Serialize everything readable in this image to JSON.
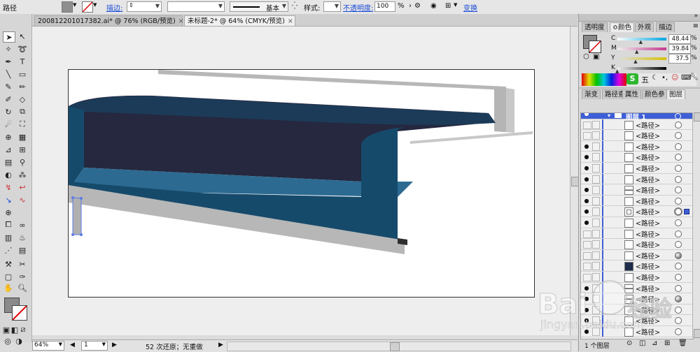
{
  "control_bar": {
    "object_type": "路径",
    "stroke_label": "描边:",
    "stroke_profile": "基本",
    "style_label": "样式:",
    "opacity_label": "不透明度:",
    "opacity_value": "100",
    "opacity_unit": "%",
    "transform_label": "变换",
    "colors": {
      "fill": "#8f8f8f",
      "link": "#1a4bd6"
    }
  },
  "tabs": [
    {
      "label": "20081220101738​2.ai* @ 76% (RGB/预览)",
      "close": "×"
    },
    {
      "label": "未标题-2* @ 64% (CMYK/预览)",
      "close": "×"
    }
  ],
  "status_bar": {
    "zoom": "64%",
    "artboard": "1",
    "message": "52 次还原；无重做"
  },
  "color_panel": {
    "tabs": [
      "透明度",
      "颜色",
      "外观",
      "描边"
    ],
    "active_tab": "颜色",
    "channels": [
      {
        "name": "C",
        "value": "48.44",
        "unit": "%",
        "level": 0.48
      },
      {
        "name": "M",
        "value": "39.84",
        "unit": "%",
        "level": 0.4
      },
      {
        "name": "Y",
        "value": "37.5",
        "unit": "%",
        "level": 0.375
      },
      {
        "name": "K",
        "value": "",
        "unit": "",
        "level": 0.0
      }
    ],
    "current_color": "#8a8a8a"
  },
  "layers_panel": {
    "tabs": [
      "渐变",
      "路径查",
      "属性",
      "颜色参",
      "图层"
    ],
    "active_tab": "图层",
    "layer_name": "图层 1",
    "footer": "1 个图层",
    "items": [
      {
        "name": "<路径>",
        "visible": false,
        "target": "empty",
        "thumb": "white"
      },
      {
        "name": "<路径>",
        "visible": false,
        "target": "empty",
        "thumb": "white"
      },
      {
        "name": "<路径>",
        "visible": true,
        "target": "empty",
        "thumb": "white"
      },
      {
        "name": "<路径>",
        "visible": true,
        "target": "empty",
        "thumb": "white"
      },
      {
        "name": "<路径>",
        "visible": true,
        "target": "empty",
        "thumb": "white"
      },
      {
        "name": "<路径>",
        "visible": true,
        "target": "empty",
        "thumb": "white"
      },
      {
        "name": "<路径>",
        "visible": true,
        "target": "empty",
        "thumb": "lines"
      },
      {
        "name": "<路径>",
        "visible": true,
        "target": "empty",
        "thumb": "white"
      },
      {
        "name": "<路径>",
        "visible": true,
        "target": "selected",
        "thumb": "frame"
      },
      {
        "name": "<路径>",
        "visible": true,
        "target": "empty",
        "thumb": "white"
      },
      {
        "name": "<路径>",
        "visible": false,
        "target": "empty",
        "thumb": "white"
      },
      {
        "name": "<路径>",
        "visible": false,
        "target": "empty",
        "thumb": "white"
      },
      {
        "name": "<路径>",
        "visible": false,
        "target": "filled",
        "thumb": "white"
      },
      {
        "name": "<路径>",
        "visible": false,
        "target": "empty",
        "thumb": "dark"
      },
      {
        "name": "<路径>",
        "visible": false,
        "target": "empty",
        "thumb": "white"
      },
      {
        "name": "<路径>",
        "visible": true,
        "target": "empty",
        "thumb": "lines"
      },
      {
        "name": "<路径>",
        "visible": true,
        "target": "filled",
        "thumb": "lines"
      },
      {
        "name": "<路径>",
        "visible": true,
        "target": "empty",
        "thumb": "white"
      },
      {
        "name": "<路径>",
        "visible": true,
        "target": "empty",
        "thumb": "white"
      },
      {
        "name": "<路径>",
        "visible": true,
        "target": "empty",
        "thumb": "white"
      }
    ]
  },
  "watermark": {
    "brand": "Bai",
    "brand_cn": "经验",
    "url": "jingyan.baidu.com"
  },
  "artwork_colors": {
    "dark_navy": "#25283f",
    "teal": "#164a6b",
    "mid_blue": "#2c6a91",
    "gray": "#b7b7b7",
    "dark": "#2e2e2e"
  }
}
